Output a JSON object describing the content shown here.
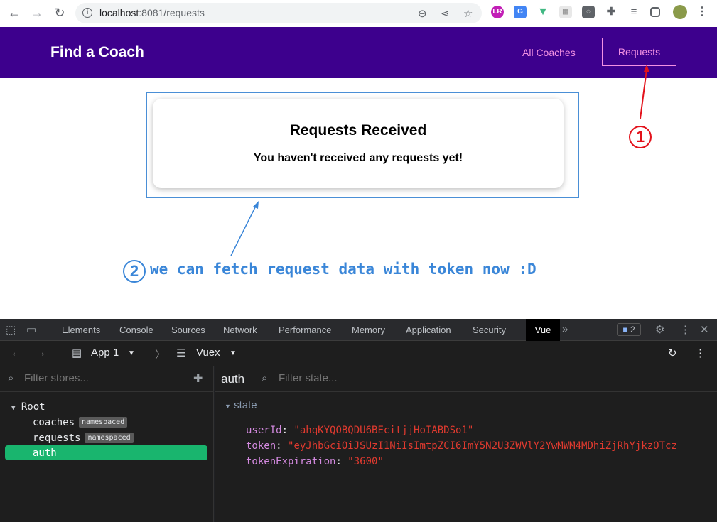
{
  "browser": {
    "url_host": "localhost",
    "url_path": ":8081/requests"
  },
  "app": {
    "brand": "Find a Coach",
    "nav": [
      "All Coaches",
      "Requests"
    ]
  },
  "card": {
    "title": "Requests Received",
    "message": "You haven't received any requests yet!"
  },
  "annotations": {
    "num1": "1",
    "num2": "2",
    "note": "we can fetch request data with token now :D",
    "color_red": "#e3121b",
    "color_blue": "#3a86d8"
  },
  "devtools": {
    "tabs": [
      "Elements",
      "Console",
      "Sources",
      "Network",
      "Performance",
      "Memory",
      "Application",
      "Security",
      "Vue"
    ],
    "badge_count": "2",
    "app_select": "App 1",
    "plugin_select": "Vuex",
    "filter_stores_placeholder": "Filter stores...",
    "module_name": "auth",
    "filter_state_placeholder": "Filter state...",
    "tree": {
      "root": "Root",
      "modules": [
        {
          "name": "coaches",
          "badge": "namespaced"
        },
        {
          "name": "requests",
          "badge": "namespaced"
        },
        {
          "name": "auth",
          "badge": ""
        }
      ]
    },
    "state_label": "state",
    "state": [
      {
        "key": "userId",
        "value": "\"ahqKYQOBQDU6BEcitjjHoIABDSo1\""
      },
      {
        "key": "token",
        "value": "\"eyJhbGciOiJSUzI1NiIsImtpZCI6ImY5N2U3ZWVlY2YwMWM4MDhiZjRhYjkzOTcz"
      },
      {
        "key": "tokenExpiration",
        "value": "\"3600\""
      }
    ]
  }
}
